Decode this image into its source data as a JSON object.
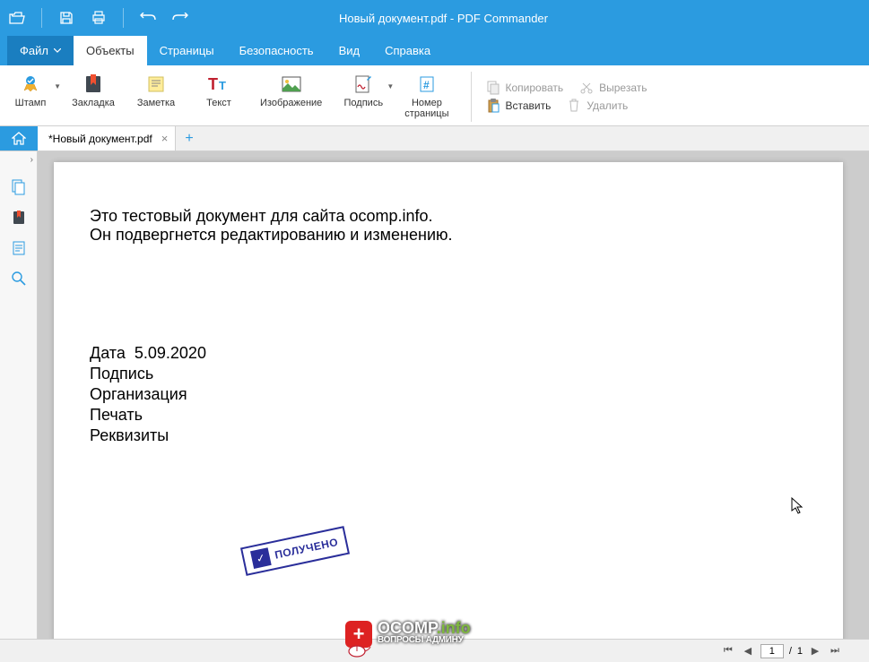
{
  "title": "Новый документ.pdf - PDF Commander",
  "menu": {
    "file": "Файл",
    "objects": "Объекты",
    "pages": "Страницы",
    "security": "Безопасность",
    "view": "Вид",
    "help": "Справка"
  },
  "ribbon": {
    "stamp": "Штамп",
    "bookmark": "Закладка",
    "note": "Заметка",
    "text": "Текст",
    "image": "Изображение",
    "signature": "Подпись",
    "pagenum": "Номер\nстраницы",
    "copy": "Копировать",
    "cut": "Вырезать",
    "paste": "Вставить",
    "delete": "Удалить"
  },
  "doctab": {
    "name": "*Новый документ.pdf"
  },
  "document": {
    "line1": "Это тестовый документ для сайта ocomp.info.",
    "line2": "Он подвергнется редактированию и изменению.",
    "date_label": "Дата",
    "date_value": "5.09.2020",
    "signature": "Подпись",
    "organization": "Организация",
    "seal": "Печать",
    "requisites": "Реквизиты",
    "stamp_text": "ПОЛУЧЕНО"
  },
  "pagenav": {
    "current": "1",
    "total": "1"
  },
  "watermark": {
    "brand": "OCOMP",
    "suffix": ".info",
    "tagline": "ВОПРОСЫ АДМИНУ"
  }
}
